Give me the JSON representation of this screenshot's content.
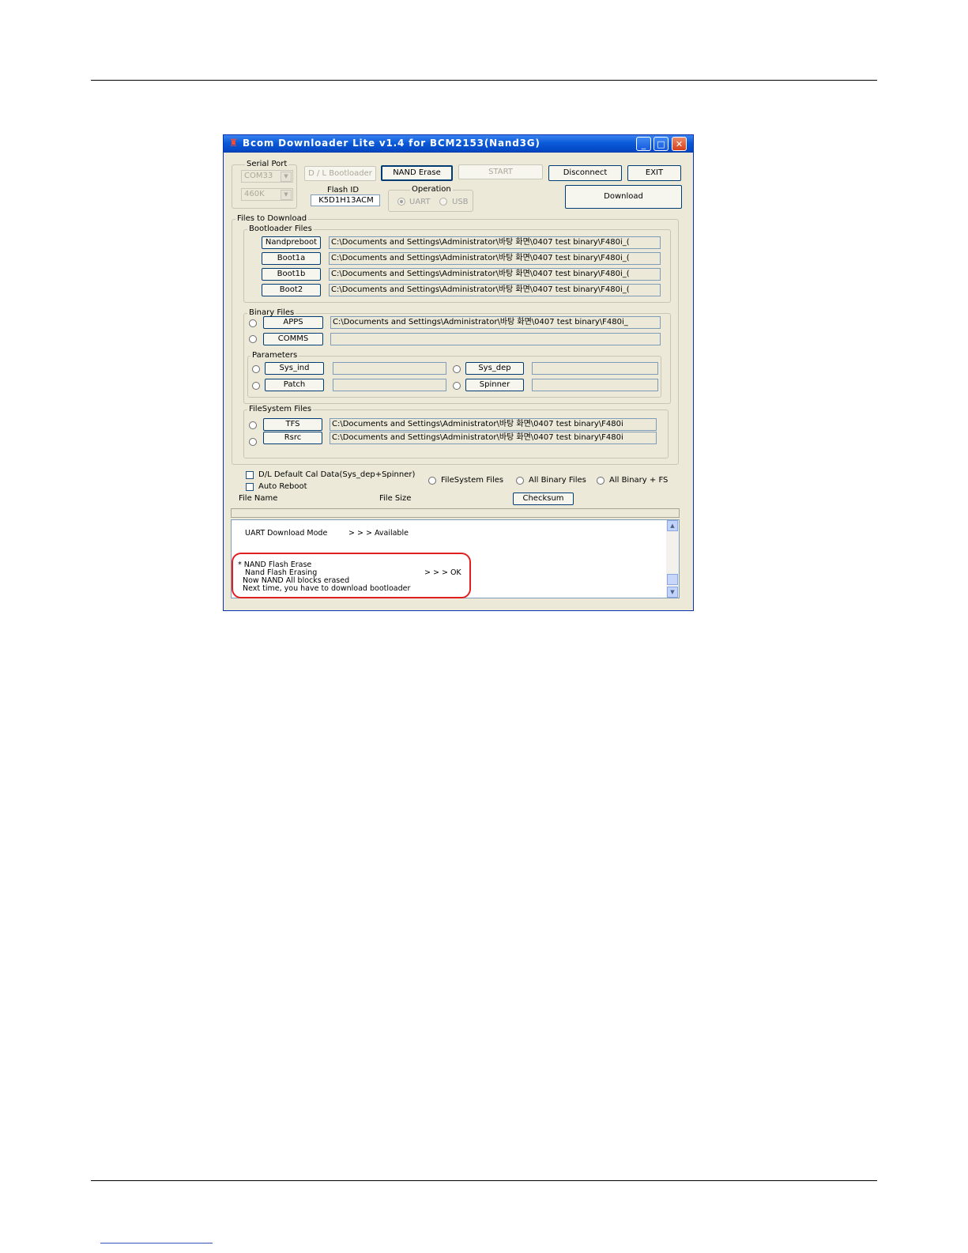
{
  "window": {
    "title": "Bcom Downloader Lite v1.4 for BCM2153(Nand3G)",
    "controls": {
      "minimize": "_",
      "maximize": "□",
      "close": "✕"
    }
  },
  "serial_port": {
    "title": "Serial Port",
    "port": "COM33",
    "baud": "460K"
  },
  "toolbar": {
    "dl_bootloader": "D / L Bootloader",
    "nand_erase": "NAND Erase",
    "start": "START",
    "disconnect": "Disconnect",
    "exit": "EXIT",
    "download": "Download"
  },
  "flash_id": {
    "label": "Flash ID",
    "value": "K5D1H13ACM"
  },
  "operation": {
    "title": "Operation",
    "uart": "UART",
    "usb": "USB",
    "selected": "UART"
  },
  "files": {
    "title": "Files to Download",
    "bootloader": {
      "title": "Bootloader Files",
      "items": [
        {
          "label": "Nandpreboot",
          "path": "C:\\Documents and Settings\\Administrator\\바탕 화면\\0407 test binary\\F480i_("
        },
        {
          "label": "Boot1a",
          "path": "C:\\Documents and Settings\\Administrator\\바탕 화면\\0407 test binary\\F480i_("
        },
        {
          "label": "Boot1b",
          "path": "C:\\Documents and Settings\\Administrator\\바탕 화면\\0407 test binary\\F480i_("
        },
        {
          "label": "Boot2",
          "path": "C:\\Documents and Settings\\Administrator\\바탕 화면\\0407 test binary\\F480i_("
        }
      ]
    },
    "binary": {
      "title": "Binary Files",
      "apps": {
        "label": "APPS",
        "path": "C:\\Documents and Settings\\Administrator\\바탕 화면\\0407 test binary\\F480i_"
      },
      "comms": {
        "label": "COMMS",
        "path": ""
      },
      "parameters": {
        "title": "Parameters",
        "sys_ind": {
          "label": "Sys_ind",
          "path": ""
        },
        "sys_dep": {
          "label": "Sys_dep",
          "path": ""
        },
        "patch": {
          "label": "Patch",
          "path": ""
        },
        "spinner": {
          "label": "Spinner",
          "path": ""
        }
      }
    },
    "filesystem": {
      "title": "FileSystem Files",
      "tfs": {
        "label": "TFS",
        "path": "C:\\Documents and Settings\\Administrator\\바탕 화면\\0407 test binary\\F480i"
      },
      "rsrc": {
        "label": "Rsrc",
        "path": "C:\\Documents and Settings\\Administrator\\바탕 화면\\0407 test binary\\F480i"
      }
    }
  },
  "options": {
    "dl_default_cal": "D/L Default Cal Data(Sys_dep+Spinner)",
    "auto_reboot": "Auto Reboot",
    "filesystem_files": "FileSystem Files",
    "all_binary_files": "All Binary Files",
    "all_binary_fs": "All Binary + FS"
  },
  "file_info": {
    "file_name": "File Name",
    "file_size": "File Size",
    "checksum": "Checksum"
  },
  "log": {
    "mode_label": "UART Download Mode",
    "mode_status": "> > > Available",
    "erase_header": "* NAND Flash Erase",
    "erasing_label": "Nand Flash Erasing",
    "erasing_status": "> > > OK",
    "erased_msg": "Now NAND All blocks erased",
    "next_msg": "Next time, you have to download bootloader"
  },
  "colors": {
    "titlebar": "#0a5ad8",
    "window_bg": "#ece9d8",
    "highlight": "#e02020"
  }
}
